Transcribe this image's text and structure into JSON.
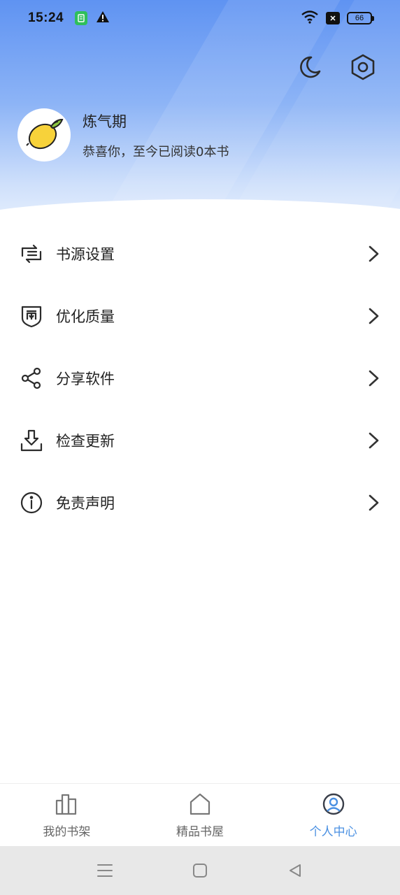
{
  "status_bar": {
    "time": "15:24",
    "battery": "66",
    "icons": [
      "app-notification-icon",
      "warning-icon",
      "wifi-icon",
      "x-box-icon",
      "battery-icon"
    ]
  },
  "header": {
    "actions": [
      "moon-icon",
      "settings-icon"
    ]
  },
  "profile": {
    "username": "炼气期",
    "reading_stat": "恭喜你，至今已阅读0本书",
    "avatar_icon": "lemon-icon"
  },
  "menu": {
    "items": [
      {
        "label": "书源设置",
        "icon": "source-settings-icon"
      },
      {
        "label": "优化质量",
        "icon": "quality-shield-icon"
      },
      {
        "label": "分享软件",
        "icon": "share-icon"
      },
      {
        "label": "检查更新",
        "icon": "download-icon"
      },
      {
        "label": "免责声明",
        "icon": "info-icon"
      }
    ]
  },
  "bottom_nav": {
    "items": [
      {
        "label": "我的书架",
        "icon": "bookshelf-icon",
        "active": false
      },
      {
        "label": "精品书屋",
        "icon": "home-icon",
        "active": false
      },
      {
        "label": "个人中心",
        "icon": "profile-icon",
        "active": true
      }
    ]
  },
  "colors": {
    "accent": "#4a90e2",
    "header_gradient_top": "#5f93f2",
    "text_primary": "#222222",
    "system_nav_bg": "#e8e8e8"
  }
}
